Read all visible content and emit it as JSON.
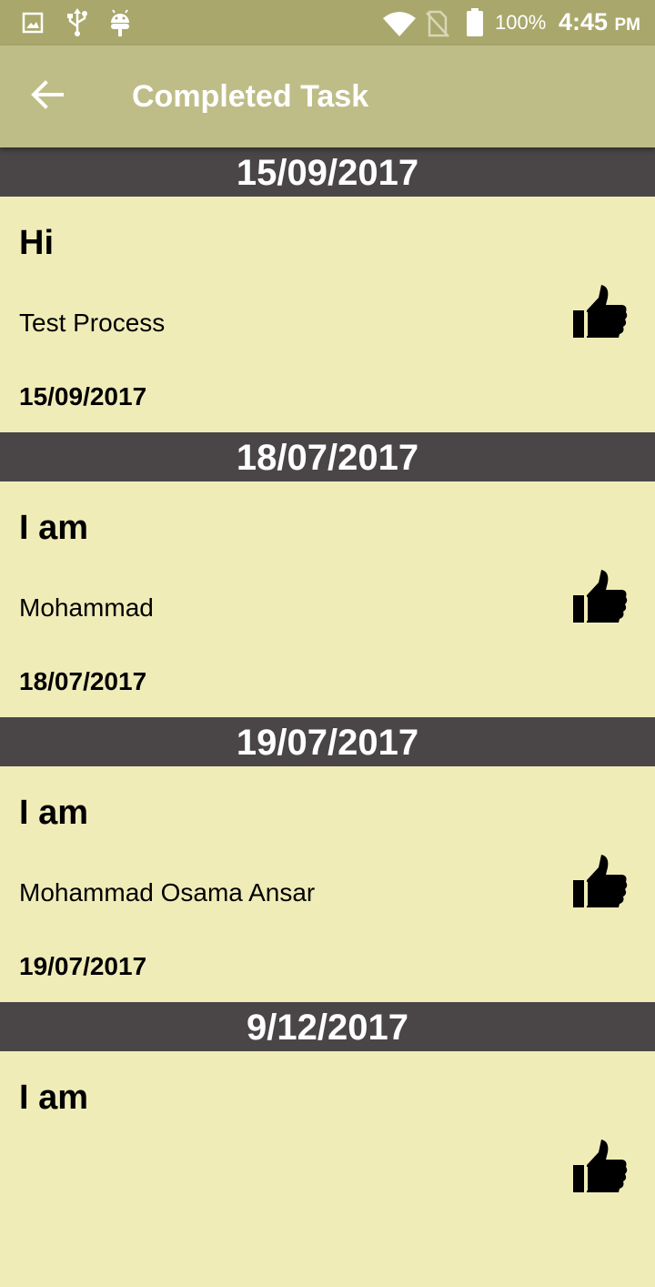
{
  "status_bar": {
    "battery_percent": "100%",
    "time": "4:45",
    "am_pm": "PM",
    "icons": [
      "image-icon",
      "usb-icon",
      "android-icon",
      "wifi-icon",
      "no-sim-icon",
      "battery-icon"
    ]
  },
  "app_bar": {
    "title": "Completed Task",
    "back_icon": "arrow-back-icon"
  },
  "colors": {
    "status_bar": "#a9a76b",
    "app_bar": "#bfbd87",
    "date_header": "#4a4648",
    "card_background": "#f0ecb8"
  },
  "tasks": [
    {
      "header_date": "15/09/2017",
      "title": "Hi",
      "description": "Test Process",
      "date": "15/09/2017",
      "icon": "thumbs-up-icon"
    },
    {
      "header_date": "18/07/2017",
      "title": "I am",
      "description": "Mohammad",
      "date": "18/07/2017",
      "icon": "thumbs-up-icon"
    },
    {
      "header_date": "19/07/2017",
      "title": "I am",
      "description": "Mohammad Osama Ansar",
      "date": "19/07/2017",
      "icon": "thumbs-up-icon"
    },
    {
      "header_date": "9/12/2017",
      "title": "I am",
      "description": "",
      "date": "",
      "icon": "thumbs-up-icon"
    }
  ]
}
